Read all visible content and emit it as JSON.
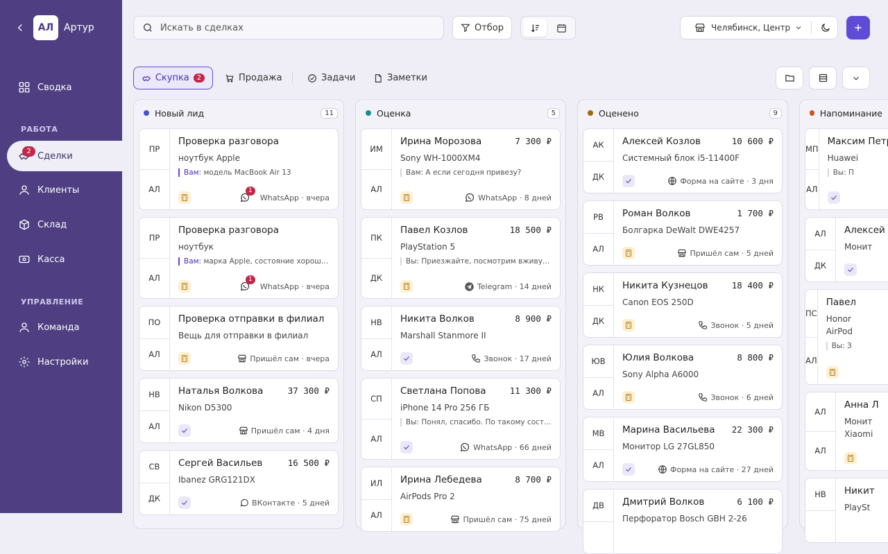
{
  "user": {
    "initials": "АЛ",
    "name": "Артур"
  },
  "nav": {
    "svodka": "Сводка",
    "section_work": "РАБОТА",
    "deals": "Сделки",
    "deals_badge": "2",
    "clients": "Клиенты",
    "warehouse": "Склад",
    "cash": "Касса",
    "section_manage": "УПРАВЛЕНИЕ",
    "team": "Команда",
    "settings": "Настройки"
  },
  "topbar": {
    "search_placeholder": "Искать в сделках",
    "filter_label": "Отбор",
    "location": "Челябинск, Центр"
  },
  "tabs": {
    "buy": "Скупка",
    "buy_badge": "2",
    "sell": "Продажа",
    "tasks": "Задачи",
    "notes": "Заметки"
  },
  "colors": {
    "accent": "#5e4bd6",
    "sidebar": "#4f3f82",
    "badge": "#c2274a"
  },
  "columns": [
    {
      "title": "Новый лид",
      "count": "11",
      "dot": "#4a4fc9",
      "cards": [
        {
          "a": "ПР",
          "b": "АЛ",
          "title": "Проверка разговора",
          "price": "",
          "product": "ноутбук Apple",
          "msg_prefix": "Вам:",
          "msg": " модель MacBook Air 13",
          "icon": "calc",
          "source": "WhatsApp · вчера",
          "src_icon": "wa",
          "unread": "1"
        },
        {
          "a": "ПР",
          "b": "АЛ",
          "title": "Проверка разговора",
          "price": "",
          "product": "ноутбук",
          "msg_prefix": "Вам:",
          "msg": " марка Apple, состояние хорошее, комплект полный",
          "icon": "calc",
          "source": "WhatsApp · вчера",
          "src_icon": "wa",
          "unread": "1"
        },
        {
          "a": "ПО",
          "b": "АЛ",
          "title": "Проверка отправки в филиал",
          "price": "",
          "product": "Вещь для отправки в филиал",
          "msg_prefix": "",
          "msg": "",
          "icon": "calc",
          "source": "Пришёл сам · вчера",
          "src_icon": "shop",
          "unread": ""
        },
        {
          "a": "НВ",
          "b": "АЛ",
          "title": "Наталья Волкова",
          "price": "37 300 ₽",
          "product": "Nikon D5300",
          "msg_prefix": "",
          "msg": "",
          "icon": "chk",
          "source": "Пришёл сам · 4 дня",
          "src_icon": "shop",
          "unread": ""
        },
        {
          "a": "СВ",
          "b": "ДК",
          "title": "Сергей Васильев",
          "price": "16 500 ₽",
          "product": "Ibanez GRG121DX",
          "msg_prefix": "",
          "msg": "",
          "icon": "chk",
          "source": "ВКонтакте · 5 дней",
          "src_icon": "vk",
          "unread": ""
        }
      ]
    },
    {
      "title": "Оценка",
      "count": "5",
      "dot": "#1c8b92",
      "cards": [
        {
          "a": "ИМ",
          "b": "АЛ",
          "title": "Ирина Морозова",
          "price": "7 300 ₽",
          "product": "Sony WH-1000XM4",
          "msg_prefix": "",
          "msg": "Вам: А если сегодня привезу?",
          "icon": "calc",
          "source": "WhatsApp · 8 дней",
          "src_icon": "wa",
          "unread": ""
        },
        {
          "a": "ПК",
          "b": "ДК",
          "title": "Павел Козлов",
          "price": "18 500 ₽",
          "product": "PlayStation 5",
          "msg_prefix": "",
          "msg": "Вы: Приезжайте, посмотрим вживую и оценим",
          "icon": "calc",
          "source": "Telegram · 14 дней",
          "src_icon": "tg",
          "unread": ""
        },
        {
          "a": "НВ",
          "b": "АЛ",
          "title": "Никита Волков",
          "price": "8 900 ₽",
          "product": "Marshall Stanmore II",
          "msg_prefix": "",
          "msg": "",
          "icon": "chk",
          "source": "Звонок · 17 дней",
          "src_icon": "phone",
          "unread": ""
        },
        {
          "a": "СП",
          "b": "АЛ",
          "title": "Светлана Попова",
          "price": "11 300 ₽",
          "product": "iPhone 14 Pro 256 ГБ",
          "msg_prefix": "",
          "msg": "Вы: Понял, спасибо. По такому состоянию",
          "icon": "chk",
          "source": "WhatsApp · 66 дней",
          "src_icon": "wa",
          "unread": ""
        },
        {
          "a": "ИЛ",
          "b": "АЛ",
          "title": "Ирина Лебедева",
          "price": "8 700 ₽",
          "product": "AirPods Pro 2",
          "msg_prefix": "",
          "msg": "",
          "icon": "calc",
          "source": "Пришёл сам · 75 дней",
          "src_icon": "shop",
          "unread": ""
        }
      ]
    },
    {
      "title": "Оценено",
      "count": "9",
      "dot": "#9a6a12",
      "cards": [
        {
          "a": "АК",
          "b": "ДК",
          "title": "Алексей Козлов",
          "price": "10 600 ₽",
          "product": "Системный блок i5-11400F",
          "msg_prefix": "",
          "msg": "",
          "icon": "chk",
          "source": "Форма на сайте · 3 дня",
          "src_icon": "globe",
          "unread": ""
        },
        {
          "a": "РВ",
          "b": "АЛ",
          "title": "Роман Волков",
          "price": "1 700 ₽",
          "product": "Болгарка DeWalt DWE4257",
          "msg_prefix": "",
          "msg": "",
          "icon": "calc",
          "source": "Пришёл сам · 5 дней",
          "src_icon": "shop",
          "unread": ""
        },
        {
          "a": "НК",
          "b": "ДК",
          "title": "Никита Кузнецов",
          "price": "18 400 ₽",
          "product": "Canon EOS 250D",
          "msg_prefix": "",
          "msg": "",
          "icon": "calc",
          "source": "Звонок · 5 дней",
          "src_icon": "phone",
          "unread": ""
        },
        {
          "a": "ЮВ",
          "b": "АЛ",
          "title": "Юлия Волкова",
          "price": "8 800 ₽",
          "product": "Sony Alpha A6000",
          "msg_prefix": "",
          "msg": "",
          "icon": "calc",
          "source": "Звонок · 6 дней",
          "src_icon": "phone",
          "unread": ""
        },
        {
          "a": "МВ",
          "b": "АЛ",
          "title": "Марина Васильева",
          "price": "22 300 ₽",
          "product": "Монитор LG 27GL850",
          "msg_prefix": "",
          "msg": "",
          "icon": "chk",
          "source": "Форма на сайте · 27 дней",
          "src_icon": "globe",
          "unread": ""
        },
        {
          "a": "ДВ",
          "b": "",
          "title": "Дмитрий Волков",
          "price": "6 100 ₽",
          "product": "Перфоратор Bosch GBH 2-26",
          "msg_prefix": "",
          "msg": "",
          "icon": "",
          "source": "",
          "src_icon": "",
          "unread": ""
        }
      ]
    },
    {
      "title": "Напоминание",
      "count": "",
      "dot": "#d0551c",
      "cards": [
        {
          "a": "МП",
          "b": "АЛ",
          "title": "Максим Петров",
          "price": "",
          "product": "Huawei",
          "msg_prefix": "",
          "msg": "Вы: П",
          "icon": "chk",
          "source": "",
          "src_icon": "",
          "unread": ""
        },
        {
          "a": "АЛ",
          "b": "ДК",
          "title": "Алексей",
          "price": "",
          "product": "Монит",
          "msg_prefix": "",
          "msg": "",
          "icon": "chk",
          "source": "",
          "src_icon": "",
          "unread": ""
        },
        {
          "a": "ПС",
          "b": "АЛ",
          "title": "Павел",
          "price": "",
          "product": "Honor",
          "product2": "AirPod",
          "msg_prefix": "",
          "msg": "Вы: З",
          "icon": "calc",
          "source": "",
          "src_icon": "",
          "unread": ""
        },
        {
          "a": "АЛ",
          "b": "АЛ",
          "title": "Анна Л",
          "price": "",
          "product": "Монит",
          "product2": "Xiaomi",
          "msg_prefix": "",
          "msg": "",
          "icon": "calc",
          "source": "",
          "src_icon": "",
          "unread": ""
        },
        {
          "a": "НВ",
          "b": "",
          "title": "Никит",
          "price": "",
          "product": "PlaySt",
          "msg_prefix": "",
          "msg": "",
          "icon": "",
          "source": "",
          "src_icon": "",
          "unread": ""
        }
      ]
    }
  ]
}
